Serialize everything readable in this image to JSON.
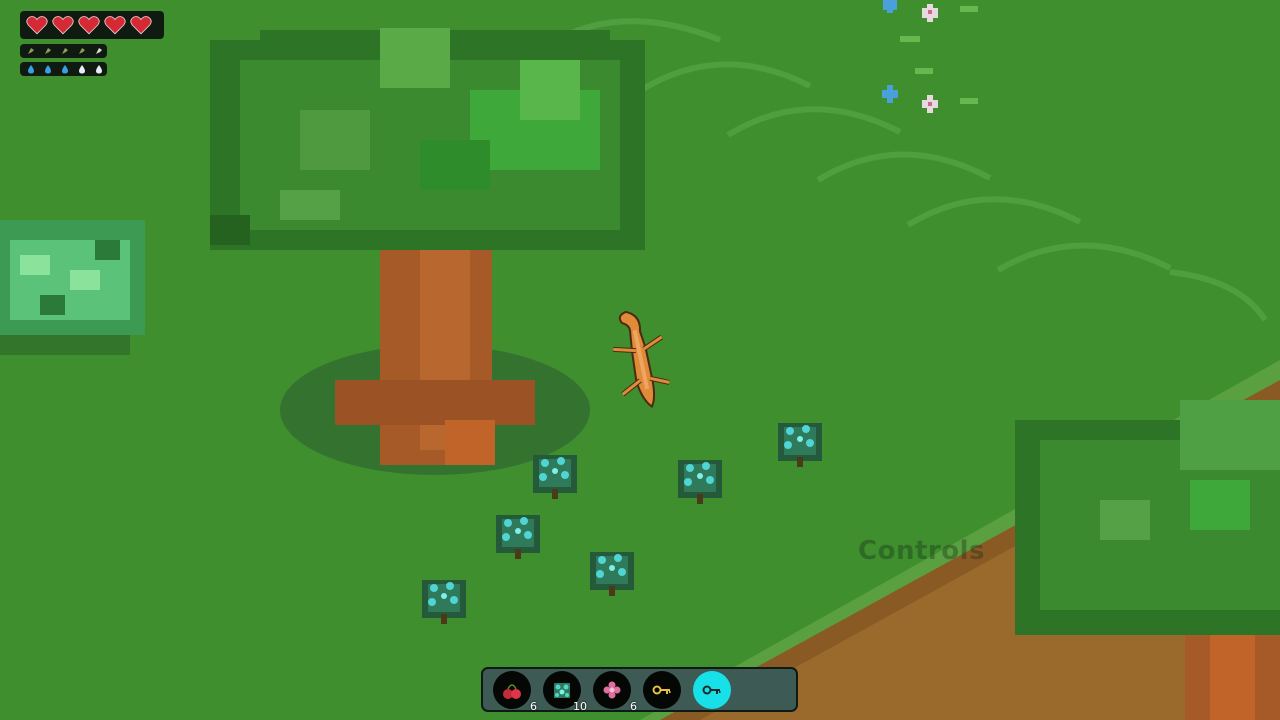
{
  "hud": {
    "health": {
      "current": 5,
      "max": 5
    },
    "hunger": {
      "current": 5,
      "max": 5
    },
    "thirst": {
      "current": 5,
      "max": 5
    }
  },
  "world": {
    "overlay_label": "Controls"
  },
  "hotbar": {
    "selected_index": 4,
    "slots": [
      {
        "item": "cherry-icon",
        "count": "6"
      },
      {
        "item": "berry-bush-icon",
        "count": "10"
      },
      {
        "item": "flower-icon",
        "count": "6"
      },
      {
        "item": "key-icon",
        "count": ""
      },
      {
        "item": "key-icon",
        "count": ""
      }
    ]
  },
  "colors": {
    "grass": "#3f8f2f",
    "heart": "#d42a36",
    "hotbar_bg": "#3e5a55",
    "selected_slot": "#18e0e8"
  }
}
